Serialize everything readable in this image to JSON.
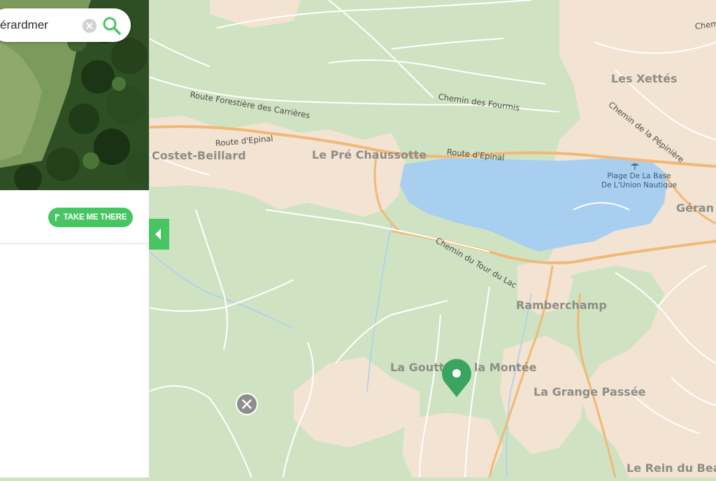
{
  "search": {
    "value": "érardmer"
  },
  "panel": {
    "action_label": "TAKE ME THERE"
  },
  "map": {
    "places": [
      "Les Xettés",
      "Costet-Beillard",
      "Le Pré Chaussotte",
      "Géran",
      "Ramberchamp",
      "La Goutt",
      "la Montée",
      "La Grange Passée",
      "Le Rein du Bea"
    ],
    "roads": [
      "Route Forestière des Carrières",
      "Chemin des Fourmis",
      "Chemin de la Pépinière",
      "Route d'Epinal",
      "Route d'Epinal",
      "Chemin du Tour du Lac",
      "Chem"
    ],
    "poi": [
      "Plage De La Base",
      "De L'Union Nautique"
    ]
  },
  "icons": {
    "search": "search-icon",
    "clear": "clear-icon",
    "flag": "flag-icon",
    "collapse": "chevron-left-icon",
    "pin": "map-pin-icon",
    "close": "close-icon",
    "beach": "beach-umbrella-icon"
  },
  "colors": {
    "accent": "#47c563",
    "water": "#a8cff0",
    "land": "#cfe3c2",
    "settlement": "#f2e3d2",
    "road": "#f1b977"
  }
}
